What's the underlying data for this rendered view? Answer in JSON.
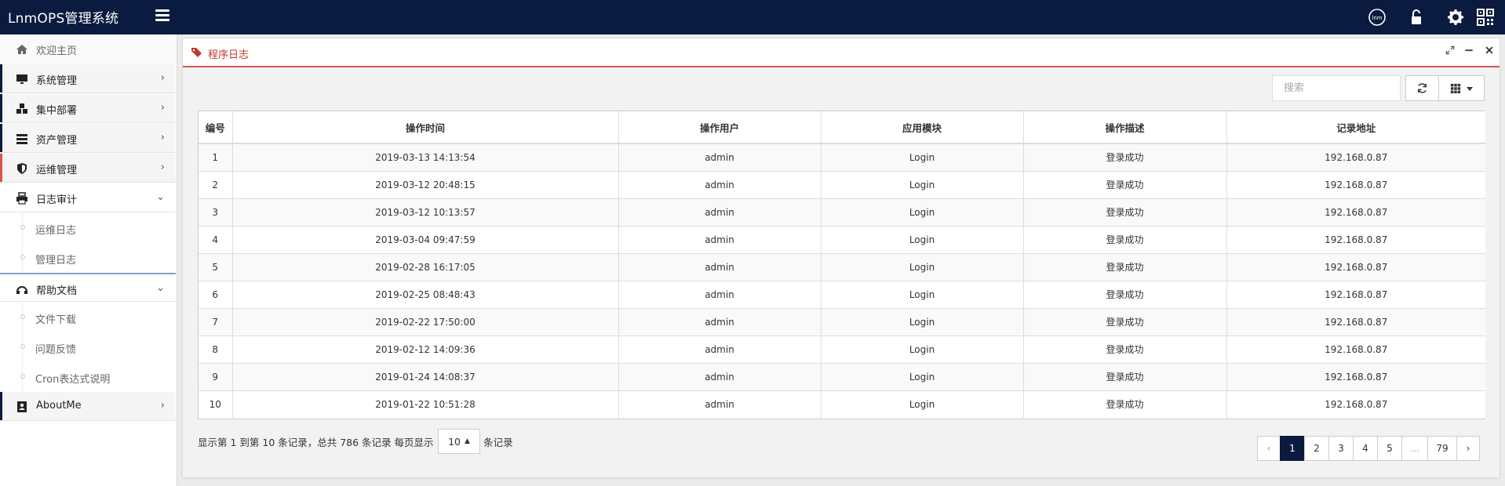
{
  "app": {
    "title": "LnmOPS管理系统"
  },
  "topbar": {
    "icons": [
      "lnm-logo-icon",
      "unlock-icon",
      "gear-icon",
      "qrcode-icon"
    ],
    "lnm_label": "lnm"
  },
  "sidebar": {
    "home": "欢迎主页",
    "items": [
      {
        "label": "系统管理",
        "icon": "desktop-icon",
        "arrow": "›"
      },
      {
        "label": "集中部署",
        "icon": "cubes-icon",
        "arrow": "›"
      },
      {
        "label": "资产管理",
        "icon": "server-icon",
        "arrow": "›"
      },
      {
        "label": "运维管理",
        "icon": "shield-icon",
        "arrow": "›"
      },
      {
        "label": "日志审计",
        "icon": "print-icon",
        "arrow": "⌄"
      },
      {
        "label": "帮助文档",
        "icon": "help-icon",
        "arrow": "⌄"
      },
      {
        "label": "AboutMe",
        "icon": "contact-icon",
        "arrow": "›"
      }
    ],
    "log_sub": [
      "运维日志",
      "管理日志"
    ],
    "help_sub": [
      "文件下载",
      "问题反馈",
      "Cron表达式说明"
    ]
  },
  "panel": {
    "title": "程序日志"
  },
  "toolbar": {
    "search_placeholder": "搜索"
  },
  "table": {
    "headers": [
      "编号",
      "操作时间",
      "操作用户",
      "应用模块",
      "操作描述",
      "记录地址"
    ],
    "rows": [
      [
        "1",
        "2019-03-13 14:13:54",
        "admin",
        "Login",
        "登录成功",
        "192.168.0.87"
      ],
      [
        "2",
        "2019-03-12 20:48:15",
        "admin",
        "Login",
        "登录成功",
        "192.168.0.87"
      ],
      [
        "3",
        "2019-03-12 10:13:57",
        "admin",
        "Login",
        "登录成功",
        "192.168.0.87"
      ],
      [
        "4",
        "2019-03-04 09:47:59",
        "admin",
        "Login",
        "登录成功",
        "192.168.0.87"
      ],
      [
        "5",
        "2019-02-28 16:17:05",
        "admin",
        "Login",
        "登录成功",
        "192.168.0.87"
      ],
      [
        "6",
        "2019-02-25 08:48:43",
        "admin",
        "Login",
        "登录成功",
        "192.168.0.87"
      ],
      [
        "7",
        "2019-02-22 17:50:00",
        "admin",
        "Login",
        "登录成功",
        "192.168.0.87"
      ],
      [
        "8",
        "2019-02-12 14:09:36",
        "admin",
        "Login",
        "登录成功",
        "192.168.0.87"
      ],
      [
        "9",
        "2019-01-24 14:08:37",
        "admin",
        "Login",
        "登录成功",
        "192.168.0.87"
      ],
      [
        "10",
        "2019-01-22 10:51:28",
        "admin",
        "Login",
        "登录成功",
        "192.168.0.87"
      ]
    ]
  },
  "pager": {
    "info": "显示第 1 到第 10 条记录，总共 786 条记录 每页显示",
    "page_size": "10",
    "page_size_arrow": "▲",
    "suffix": "条记录",
    "prev": "‹",
    "next": "›",
    "pages": [
      "1",
      "2",
      "3",
      "4",
      "5",
      "...",
      "79"
    ],
    "active_page": "1"
  },
  "colors": {
    "navbar": "#0a1b3f",
    "accent_red": "#d9534f",
    "active_page": "#0a1b3f"
  }
}
